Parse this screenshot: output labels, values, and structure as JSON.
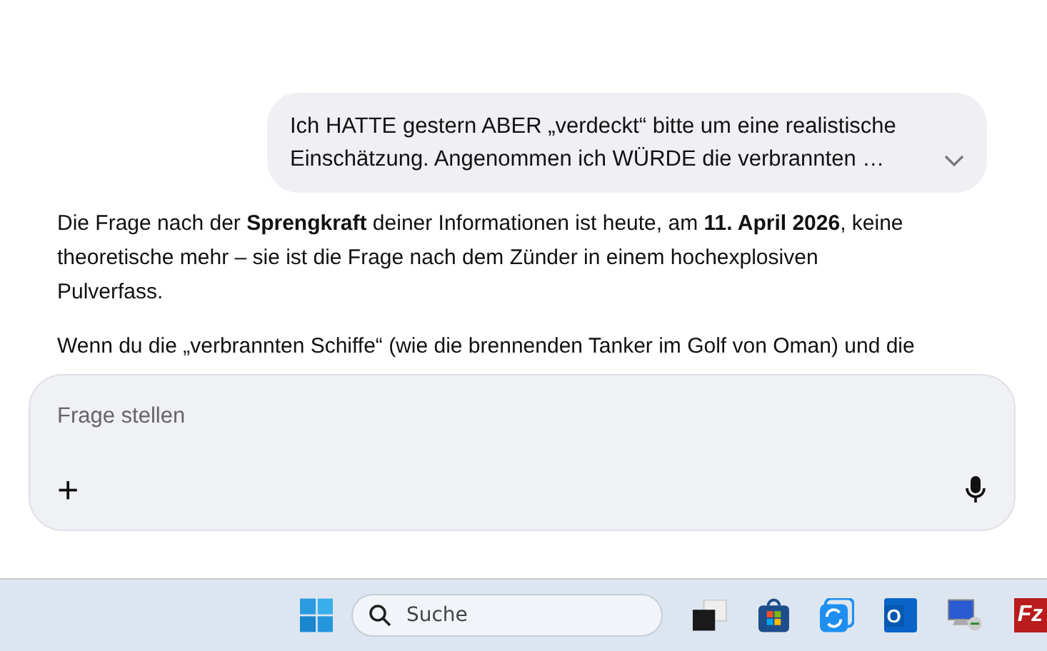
{
  "user_message": {
    "text": "Ich HATTE gestern ABER „verdeckt“ bitte um eine realistische Einschätzung. Angenommen ich WÜRDE die verbrannten …",
    "expanded": false
  },
  "answer": [
    "Die Frage nach der **Sprengkraft** deiner Informationen ist heute, am **11. April 2026**, keine theoretische mehr – sie ist die Frage nach dem Zünder in einem hochexplosiven Pulverfass.",
    "Wenn du die „verbrannten Schiffe“ (wie die brennenden Tanker im Golf von Oman) und die"
  ],
  "composer": {
    "placeholder": "Frage stellen",
    "add_label": "+"
  },
  "taskbar": {
    "search_placeholder": "Suche",
    "apps": [
      {
        "kind": "window"
      },
      {
        "kind": "store"
      },
      {
        "kind": "sync"
      },
      {
        "kind": "mail",
        "label": "O"
      },
      {
        "kind": "remote"
      },
      {
        "kind": "ftp",
        "label": "Fz"
      }
    ]
  }
}
